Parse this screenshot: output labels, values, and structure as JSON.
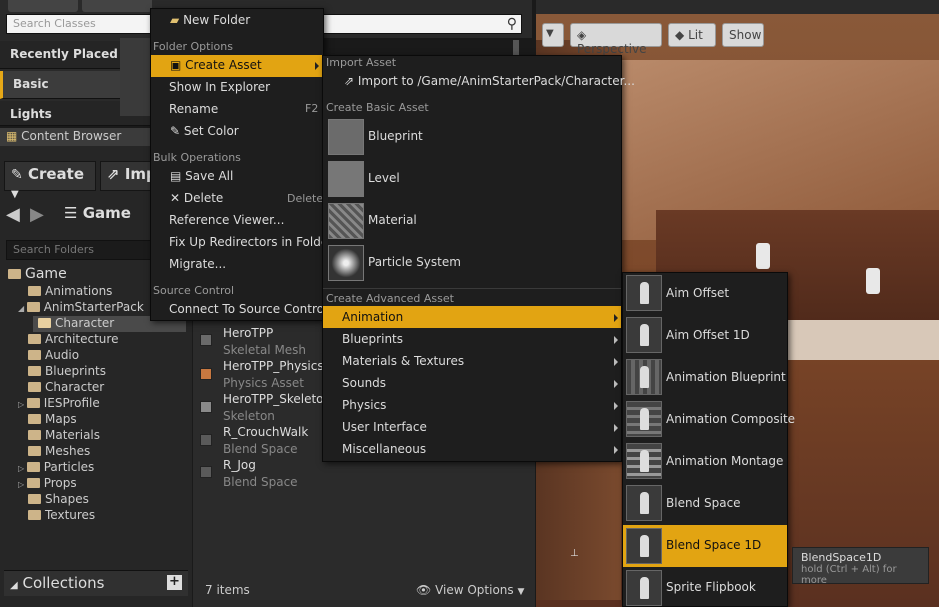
{
  "placement": {
    "search_placeholder": "Search Classes",
    "categories": [
      "Recently Placed",
      "Basic",
      "Lights"
    ]
  },
  "content_browser": {
    "tab_title": "Content Browser",
    "create_label": "Create",
    "import_label": "Imp",
    "path_label": "Game",
    "search_folders_placeholder": "Search Folders",
    "tree": [
      {
        "label": "Game",
        "depth": 0
      },
      {
        "label": "Animations",
        "depth": 1
      },
      {
        "label": "AnimStarterPack",
        "depth": 1
      },
      {
        "label": "Character",
        "depth": 2
      },
      {
        "label": "Architecture",
        "depth": 1
      },
      {
        "label": "Audio",
        "depth": 1
      },
      {
        "label": "Blueprints",
        "depth": 1
      },
      {
        "label": "Character",
        "depth": 1
      },
      {
        "label": "IESProfile",
        "depth": 1
      },
      {
        "label": "Maps",
        "depth": 1
      },
      {
        "label": "Materials",
        "depth": 1
      },
      {
        "label": "Meshes",
        "depth": 1
      },
      {
        "label": "Particles",
        "depth": 1
      },
      {
        "label": "Props",
        "depth": 1
      },
      {
        "label": "Shapes",
        "depth": 1
      },
      {
        "label": "Textures",
        "depth": 1
      }
    ],
    "collections_label": "Collections",
    "assets": [
      {
        "name": "HeroTPP",
        "type": "Skeletal Mesh"
      },
      {
        "name": "HeroTPP_Physics",
        "type": "Physics Asset"
      },
      {
        "name": "HeroTPP_Skeleton",
        "type": "Skeleton"
      },
      {
        "name": "R_CrouchWalk",
        "type": "Blend Space"
      },
      {
        "name": "R_Jog",
        "type": "Blend Space"
      }
    ],
    "item_count": "7 items",
    "view_options": "View Options"
  },
  "viewport": {
    "perspective_label": "Perspective",
    "lit_label": "Lit",
    "show_label": "Show"
  },
  "folder_menu": {
    "new_folder": "New Folder",
    "folder_options_header": "Folder Options",
    "create_asset": "Create Asset",
    "show_in_explorer": "Show In Explorer",
    "rename": "Rename",
    "rename_shortcut": "F2",
    "set_color": "Set Color",
    "bulk_header": "Bulk Operations",
    "save_all": "Save All",
    "delete": "Delete",
    "delete_shortcut": "Delete",
    "reference_viewer": "Reference Viewer...",
    "fix_up": "Fix Up Redirectors in Folder",
    "migrate": "Migrate...",
    "source_header": "Source Control",
    "connect_source": "Connect To Source Control"
  },
  "asset_menu": {
    "import_header": "Import Asset",
    "import_to": "Import to /Game/AnimStarterPack/Character...",
    "basic_header": "Create Basic Asset",
    "basic": [
      "Blueprint",
      "Level",
      "Material",
      "Particle System"
    ],
    "advanced_header": "Create Advanced Asset",
    "advanced": [
      "Animation",
      "Blueprints",
      "Materials & Textures",
      "Sounds",
      "Physics",
      "User Interface",
      "Miscellaneous"
    ]
  },
  "animation_menu": {
    "items": [
      "Aim Offset",
      "Aim Offset 1D",
      "Animation Blueprint",
      "Animation Composite",
      "Animation Montage",
      "Blend Space",
      "Blend Space 1D",
      "Sprite Flipbook"
    ]
  },
  "tooltip": {
    "title": "BlendSpace1D",
    "hint": "hold (Ctrl + Alt) for more"
  },
  "colors": {
    "accent": "#e2a412",
    "menu_bg": "#1e1e1e",
    "panel_bg": "#262626"
  }
}
